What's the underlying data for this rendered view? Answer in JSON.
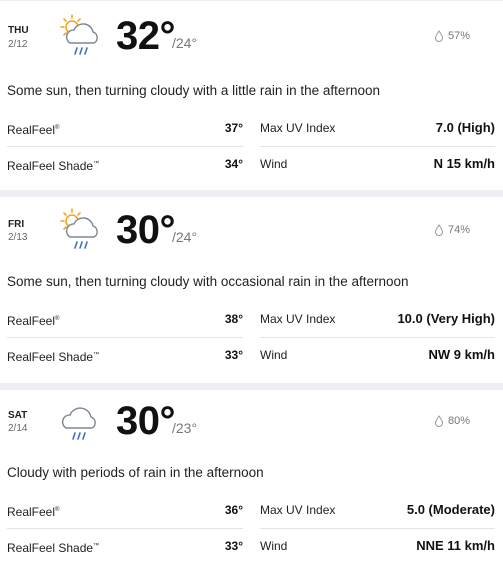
{
  "days": [
    {
      "dow": "THU",
      "date": "2/12",
      "icon": "sun-cloud-rain-icon",
      "high": "32°",
      "low": "/24°",
      "precip": "57%",
      "phrase": "Some sun, then turning cloudy with a little rain in the afternoon",
      "realfeel_label": "RealFeel",
      "realfeel": "37°",
      "uv_label": "Max UV Index",
      "uv": "7.0 (High)",
      "shade_label": "RealFeel Shade",
      "shade": "34°",
      "wind_label": "Wind",
      "wind": "N 15 km/h"
    },
    {
      "dow": "FRI",
      "date": "2/13",
      "icon": "sun-cloud-rain-icon",
      "high": "30°",
      "low": "/24°",
      "precip": "74%",
      "phrase": "Some sun, then turning cloudy with occasional rain in the afternoon",
      "realfeel_label": "RealFeel",
      "realfeel": "38°",
      "uv_label": "Max UV Index",
      "uv": "10.0 (Very High)",
      "shade_label": "RealFeel Shade",
      "shade": "33°",
      "wind_label": "Wind",
      "wind": "NW 9 km/h"
    },
    {
      "dow": "SAT",
      "date": "2/14",
      "icon": "cloud-rain-icon",
      "high": "30°",
      "low": "/23°",
      "precip": "80%",
      "phrase": "Cloudy with periods of rain in the afternoon",
      "realfeel_label": "RealFeel",
      "realfeel": "36°",
      "uv_label": "Max UV Index",
      "uv": "5.0 (Moderate)",
      "shade_label": "RealFeel Shade",
      "shade": "33°",
      "wind_label": "Wind",
      "wind": "NNE 11 km/h"
    }
  ],
  "colors": {
    "sun": "#f2a81d",
    "cloud_stroke": "#7a8696",
    "rain": "#3b73c4",
    "divider": "#eceef1"
  }
}
